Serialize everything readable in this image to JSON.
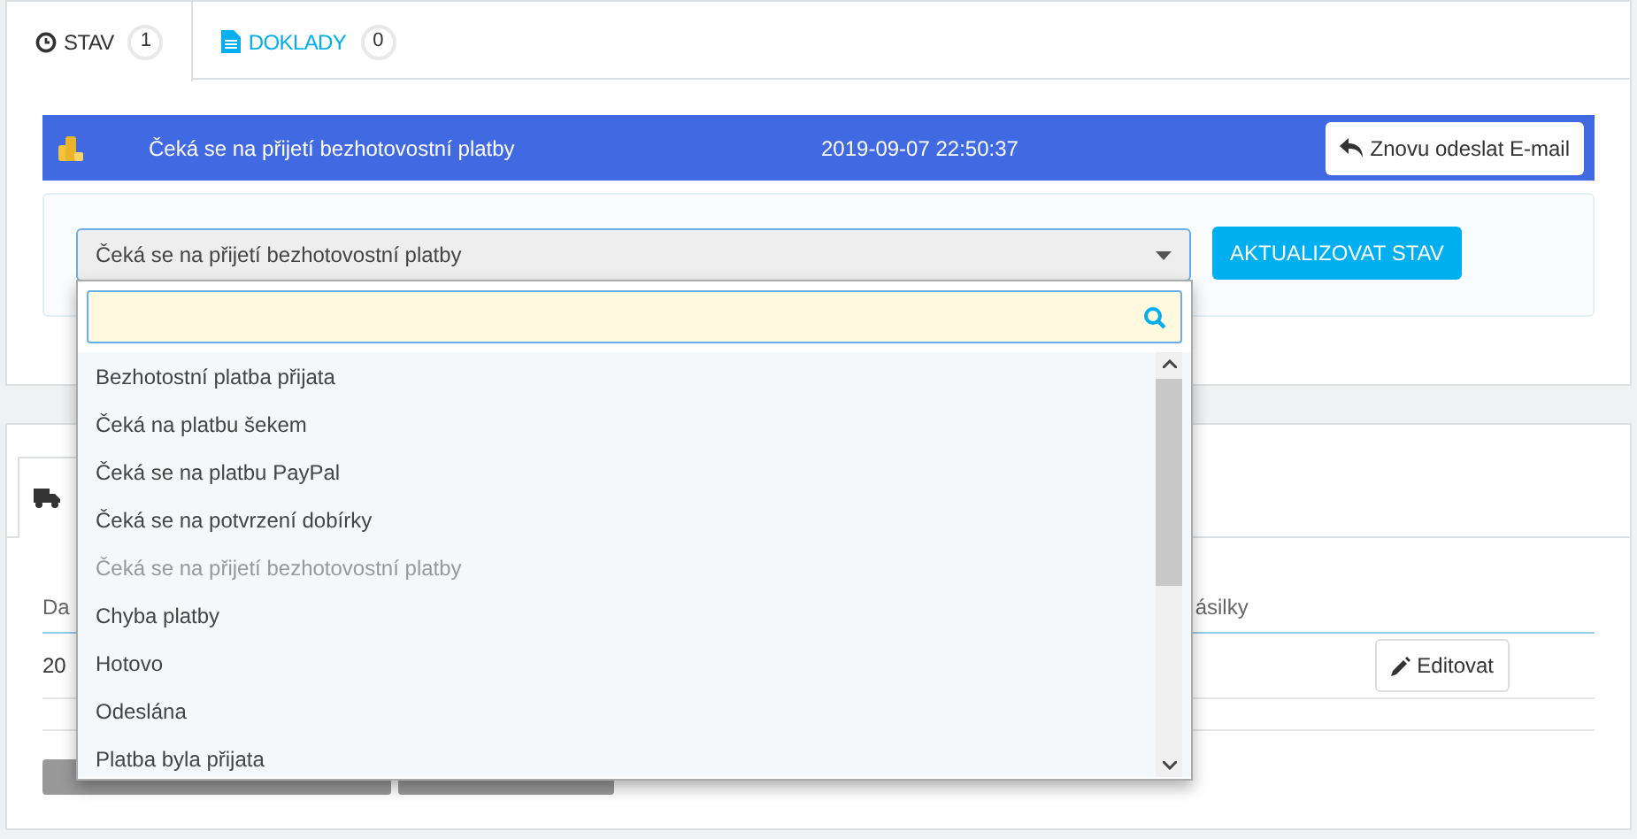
{
  "tabs": [
    {
      "label": "STAV",
      "count": "1",
      "selected": true
    },
    {
      "label": "DOKLADY",
      "count": "0",
      "selected": false
    }
  ],
  "status_bar": {
    "label": "Čeká se na přijetí bezhotovostní platby",
    "date": "2019-09-07 22:50:37",
    "resend_button": "Znovu odeslat E-mail"
  },
  "status_select": {
    "value": "Čeká se na přijetí bezhotovostní platby",
    "expanded": true
  },
  "update_button": "AKTUALIZOVAT STAV",
  "dropdown": {
    "options": [
      {
        "label": "Bezhotostní platba přijata",
        "disabled": false
      },
      {
        "label": "Čeká na platbu šekem",
        "disabled": false
      },
      {
        "label": "Čeká se na platbu PayPal",
        "disabled": false
      },
      {
        "label": "Čeká se na potvrzení dobírky",
        "disabled": false
      },
      {
        "label": "Čeká se na přijetí bezhotovostní platby",
        "disabled": true
      },
      {
        "label": "Chyba platby",
        "disabled": false
      },
      {
        "label": "Hotovo",
        "disabled": false
      },
      {
        "label": "Odeslána",
        "disabled": false
      },
      {
        "label": "Platba byla přijata",
        "disabled": false
      }
    ]
  },
  "shipping": {
    "table": {
      "columns": [
        "Da",
        "ásilky"
      ],
      "rows": [
        {
          "cells": [
            "20"
          ],
          "button": "Editovat"
        }
      ]
    }
  }
}
